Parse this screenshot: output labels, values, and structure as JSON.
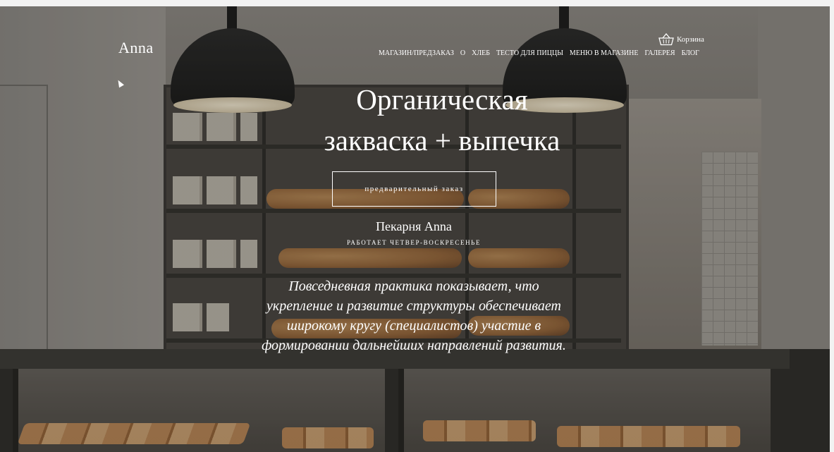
{
  "site": {
    "logo": "Anna",
    "nav": [
      "МАГАЗИН/ПРЕДЗАКАЗ",
      "О",
      "ХЛЕБ",
      "ТЕСТО ДЛЯ ПИЦЦЫ",
      "МЕНЮ В МАГАЗИНЕ",
      "ГАЛЕРЕЯ",
      "БЛОГ"
    ],
    "cart_label": "Корзина",
    "cart_icon": "basket-icon"
  },
  "hero": {
    "title_line1": "Органическая",
    "title_line2": "закваска + выпечка",
    "button_label": "предварительный заказ",
    "bakery_name": "Пекарня Anna",
    "hours": "РАБОТАЕТ ЧЕТВЕР-ВОСКРЕСЕНЬЕ",
    "description": "Повседневная практика показывает, что укрепление и развитие структуры обеспечивает широкому кругу (специалистов) участие в формировании дальнейших направлений развития."
  },
  "colors": {
    "text": "#ffffff",
    "lamp": "#1b1b1b",
    "counter": "#2f2d2b"
  }
}
